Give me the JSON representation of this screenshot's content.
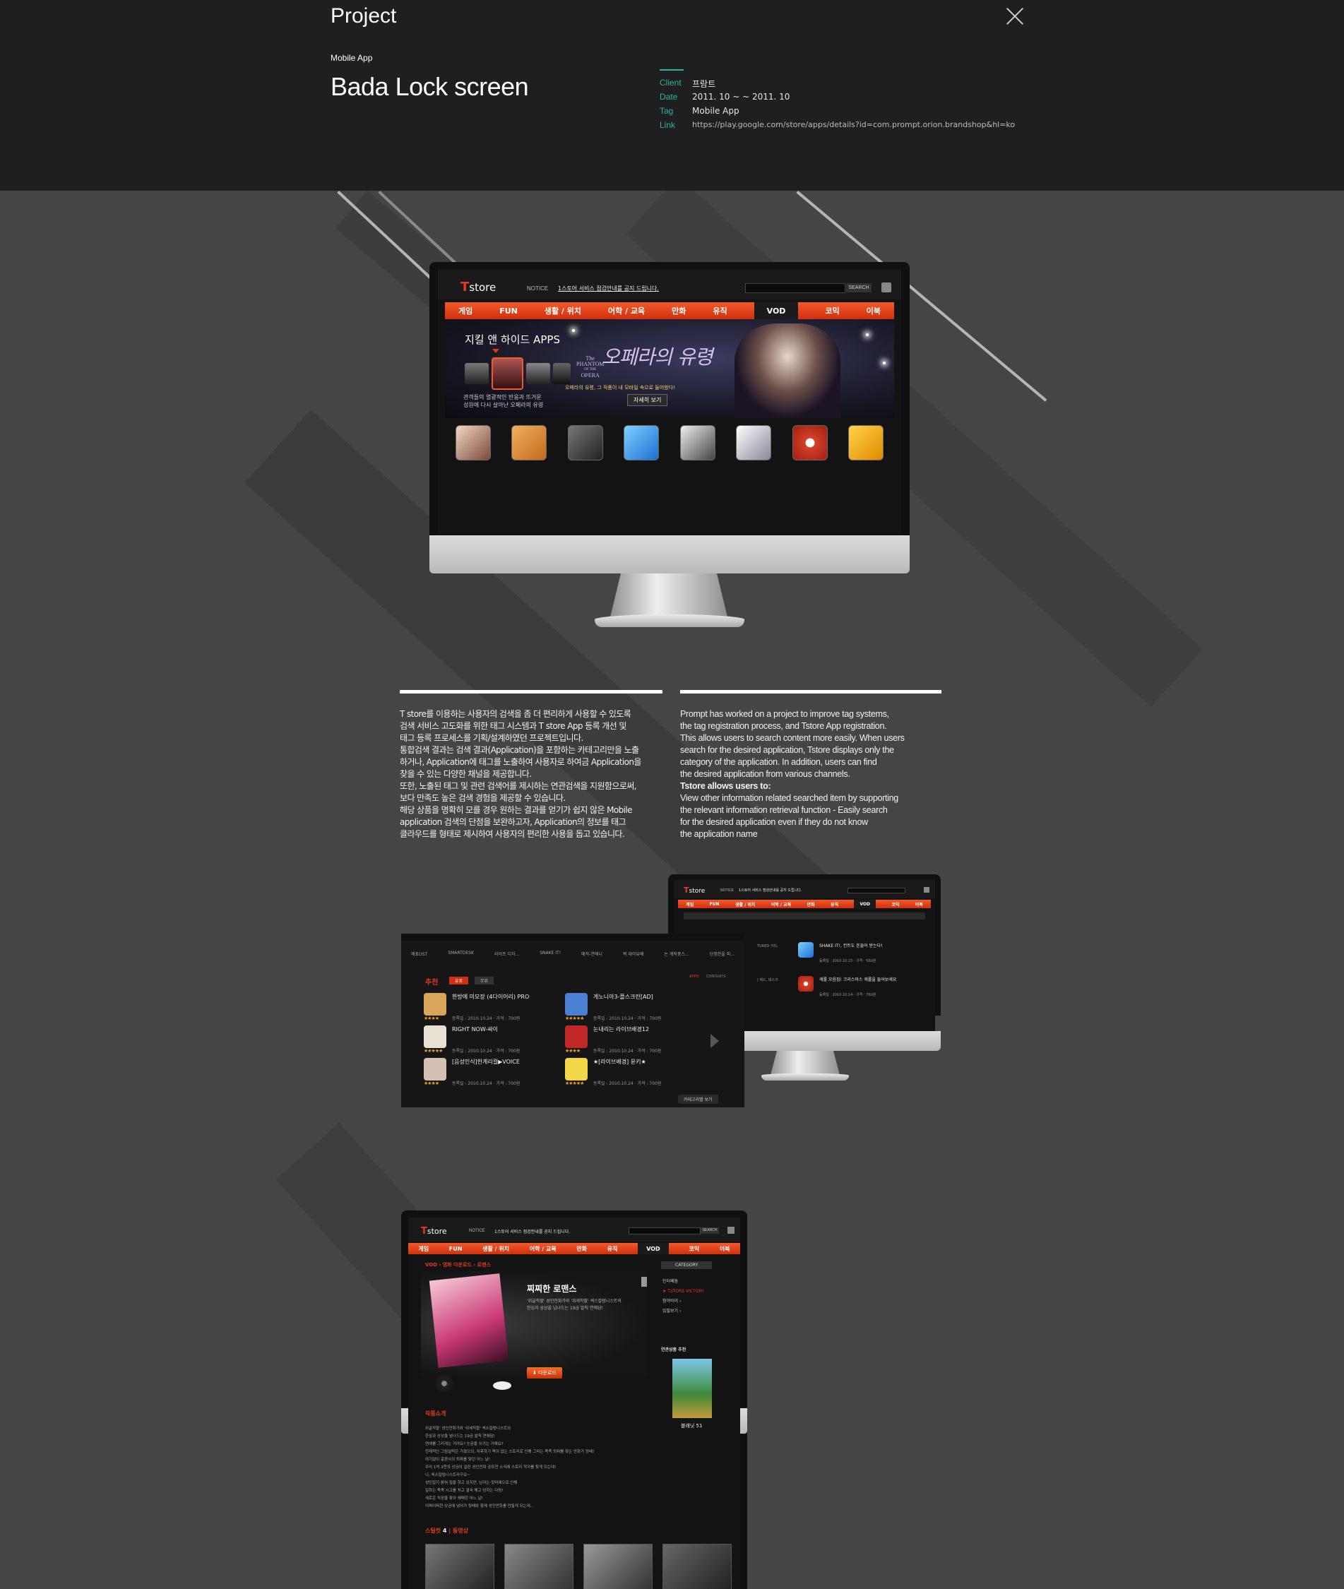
{
  "header": {
    "title": "Project",
    "category": "Mobile App",
    "app_title": "Bada Lock screen",
    "meta": [
      {
        "key": "Client",
        "value": "프람트"
      },
      {
        "key": "Date",
        "value": "2011. 10 ~ ~ 2011. 10"
      },
      {
        "key": "Tag",
        "value": "Mobile App"
      },
      {
        "key": "Link",
        "value": "https://play.google.com/store/apps/details?id=com.prompt.orion.brandshop&hl=ko"
      }
    ]
  },
  "icons": {
    "close": "close-icon"
  },
  "colors": {
    "header_bg": "#1f1f1f",
    "main_bg": "#454545",
    "accent": "#2bb39a",
    "nav_red": "#e23b18"
  },
  "store": {
    "logo_t": "T",
    "logo_text": "store",
    "notice_label": "NOTICE",
    "notice_text": "1스토어 서비스 점검안내를 공지 드립니다.",
    "search_button": "SEARCH",
    "nav": [
      "게임",
      "FUN",
      "생활 / 위치",
      "어학 / 교육",
      "만화",
      "유직",
      "VOD",
      "코믹",
      "이북"
    ],
    "hero": {
      "heading": "지킬 앤 하이드 APPS",
      "desc_line1": "관객들의 열광적인 반응과 뜨거운",
      "desc_line2": "성원에 다시 살아난 오페라의 유령",
      "poster_title_kr": "오페라의 유령",
      "poster_title_en_1": "The",
      "poster_title_en_2": "PHANTOM",
      "poster_title_en_3": "OF THE",
      "poster_title_en_4": "OPERA",
      "poster_caption": "오페라의 유령, 그 작품이 내 모바일 속으로 들어왔다!",
      "detail_button": "자세히 보기"
    }
  },
  "description": {
    "korean": [
      "T store를 이용하는 사용자의 검색을 좀 더 편리하게 사용할 수 있도록",
      "검색 서비스 고도화를 위한 태그 시스템과 T store App 등록 개선 및",
      "태그 등록 프로세스를 기획/설계하였던 프로젝트입니다.",
      "통합검색 결과는 검색 결과(Application)을 포함하는 카테고리만을 노출",
      "하거나, Application에 태그를 노출하여 사용자로 하여금 Application을",
      "찾을 수 있는 다양한 채널을 제공합니다.",
      "또한, 노출된 태그 및 관련 검색어를 제시하는 연관검색을 지원함으로써,",
      "보다 만족도 높은 검색 경험을 제공할 수 있습니다.",
      "해당 상품을 명확히 모를 경우 원하는 결과를 얻기가 쉽지 않은 Mobile",
      "application 검색의 단점을 보완하고자, Application의 정보를 태그",
      "클라우드를 형태로 제시하여 사용자의 편리한 사용을 돕고 있습니다."
    ],
    "english": [
      "Prompt has worked on a project to improve tag systems,",
      "the tag registration process, and Tstore App registration.",
      "This allows users to search content more easily. When users",
      "search for the desired application, Tstore displays only the",
      "category of the application. In addition, users can find",
      "the desired application from various channels."
    ],
    "english_bold": "Tstore allows users to:",
    "english_tail": [
      "View other information related searched item by supporting",
      "the relevant information retrieval function - Easily search",
      "for the desired application even if they do not know",
      "the application name"
    ]
  },
  "list_screen": {
    "section_label": "추천",
    "tabs": [
      "유료",
      "무료"
    ],
    "right_tabs": [
      "APPS",
      "CONTENTS"
    ],
    "categories": [
      "매표OST",
      "SMARTDESK",
      "라이프 디자...",
      "SNAKE IT!",
      "메직-연애니",
      "벽 대아유배",
      "논 캐릭풍스...",
      "단정한을 피..."
    ],
    "items": [
      {
        "title": "한방에 미모장 (4다이어리) PRO",
        "date": "등록일 : 2010.10.24 · 가격 : 700원",
        "color": "#d9a55b"
      },
      {
        "title": "게노니아3-플스크린[AD]",
        "date": "등록일 : 2010.10.24 · 가격 : 700원",
        "color": "#4a7fd1"
      },
      {
        "title": "RIGHT NOW-싸이",
        "date": "등록일 : 2010.10.24 · 가격 : 700원",
        "color": "#e9e0d4"
      },
      {
        "title": "눈내리는 라이브배경12",
        "date": "등록일 : 2010.10.24 · 가격 : 700원",
        "color": "#c02828"
      },
      {
        "title": "[음성인식]한계리컬▶VOICE",
        "date": "등록일 : 2010.10.24 · 가격 : 700원",
        "color": "#d6c0b4"
      },
      {
        "title": "★[라이브배경] 윤키★",
        "date": "등록일 : 2010.10.24 · 가격 : 700원",
        "color": "#f0d84a"
      }
    ],
    "more_button": "카테고리별 보기"
  },
  "small_screen": {
    "items": [
      {
        "title": "SHAKE IT!, 컨트도 흔들어 받는다!",
        "date": "등록일 : 2010.10.15 · 가격 : 500원"
      },
      {
        "title": "캐롤 모음집! 크리스마스 캐롤을 들어보세요",
        "date": "등록일 : 2010.10.14 · 가격 : 700원"
      }
    ],
    "left_labels": [
      "TURED 거미,",
      "| 제드, 대스크"
    ]
  },
  "detail_screen": {
    "breadcrumb": "VOD › 영화 다운로드 › 로맨스",
    "title": "찌찌한 로맨스",
    "summary_1": "'위글작할' 성인만화가와 '위세작할' 섹스칼럼니스트의",
    "summary_2": "한심과 상상을 넘나드는 19금 발칙 연애담!",
    "download_button": "다운로드",
    "section_title": "작품소개",
    "category_button": "CATEGORY",
    "side_menu": [
      "인터페돔",
      "TSTORE VICTORY",
      "참야바이 ›",
      "입필보기 ›"
    ],
    "recommend_label": "연관상품 추천",
    "recommend_title": "블래닛 51",
    "stills_label": "스틸컷",
    "stills_count": "4",
    "video_label": "동영상",
    "synopsis": [
      "위글작할' 성인만화가와 '위세작할' 섹스칼럼니스트의",
      "한심과 상상을 넘나드는 19금 발칙 연애담!",
      "연애를 그리게는 거야요? 눈문을 쓰거는 거예요?",
      "천재적인 그림실력은 가졌으되, 자후하기 짝이 없는 스토리로 인해 그리는 족족 퇴짜를 맞는 만화가 정배!",
      "여기없이 출판사의 퇴짜를 맞던 어느 날!",
      "우리 1억 3천의 상금이 걸린 성인만화 공모전 소식에 스토리 작가를 찾게 되는데!",
      "나, 섹스칼럼니스트라구요~",
      "성인잡지 밝혀 일을 하고 있지만, 남자는 장미에으로 인해",
      "일하는 족족 시고를 치고 결국 해고 당하는 다림!",
      "새로운 직장을 찾아 헤매던 어느 날!",
      "어쩌어쩌한 상금에 넘어가 정배와 함께 성인만화를 만들게 되는데..."
    ]
  }
}
